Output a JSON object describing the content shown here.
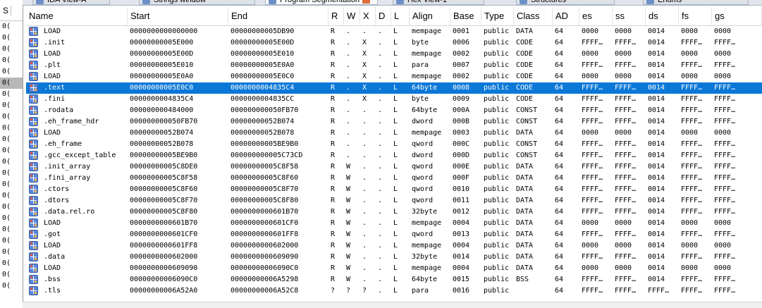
{
  "tabs": [
    {
      "label": "IDA View-A",
      "active": false
    },
    {
      "label": "Strings window",
      "active": false
    },
    {
      "label": "Program Segmentation",
      "active": true
    },
    {
      "label": "Hex View-1",
      "active": false
    },
    {
      "label": "Structures",
      "active": false
    },
    {
      "label": "Enums",
      "active": false
    }
  ],
  "left_panel": {
    "header": "S",
    "row_text": "0("
  },
  "columns": [
    "Name",
    "Start",
    "End",
    "R",
    "W",
    "X",
    "D",
    "L",
    "Align",
    "Base",
    "Type",
    "Class",
    "AD",
    "es",
    "ss",
    "ds",
    "fs",
    "gs"
  ],
  "selected_row": 5,
  "rows": [
    [
      "LOAD",
      "0000000000000000",
      "00000000005DB90",
      "R",
      ".",
      ".",
      ".",
      "L",
      "mempage",
      "0001",
      "public",
      "DATA",
      "64",
      "0000",
      "0000",
      "0014",
      "0000",
      "0000"
    ],
    [
      ".init",
      "00000000005E000",
      "00000000005E00D",
      "R",
      ".",
      "X",
      ".",
      "L",
      "byte",
      "0006",
      "public",
      "CODE",
      "64",
      "FFFF…",
      "FFFF…",
      "0014",
      "FFFF…",
      "FFFF…"
    ],
    [
      "LOAD",
      "00000000005E00D",
      "00000000005E010",
      "R",
      ".",
      "X",
      ".",
      "L",
      "mempage",
      "0002",
      "public",
      "CODE",
      "64",
      "0000",
      "0000",
      "0014",
      "0000",
      "0000"
    ],
    [
      ".plt",
      "00000000005E010",
      "00000000005E0A0",
      "R",
      ".",
      "X",
      ".",
      "L",
      "para",
      "0007",
      "public",
      "CODE",
      "64",
      "FFFF…",
      "FFFF…",
      "0014",
      "FFFF…",
      "FFFF…"
    ],
    [
      "LOAD",
      "00000000005E0A0",
      "00000000005E0C0",
      "R",
      ".",
      "X",
      ".",
      "L",
      "mempage",
      "0002",
      "public",
      "CODE",
      "64",
      "0000",
      "0000",
      "0014",
      "0000",
      "0000"
    ],
    [
      ".text",
      "00000000005E0C0",
      "0000000004835C4",
      "R",
      ".",
      "X",
      ".",
      "L",
      "64byte",
      "0008",
      "public",
      "CODE",
      "64",
      "FFFF…",
      "FFFF…",
      "0014",
      "FFFF…",
      "FFFF…"
    ],
    [
      ".fini",
      "0000000004835C4",
      "0000000004835CC",
      "R",
      ".",
      "X",
      ".",
      "L",
      "byte",
      "0009",
      "public",
      "CODE",
      "64",
      "FFFF…",
      "FFFF…",
      "0014",
      "FFFF…",
      "FFFF…"
    ],
    [
      ".rodata",
      "000000000484000",
      "000000000050FB70",
      "R",
      ".",
      ".",
      ".",
      "L",
      "64byte",
      "000A",
      "public",
      "CONST",
      "64",
      "FFFF…",
      "FFFF…",
      "0014",
      "FFFF…",
      "FFFF…"
    ],
    [
      ".eh_frame_hdr",
      "000000000050FB70",
      "00000000052B074",
      "R",
      ".",
      ".",
      ".",
      "L",
      "dword",
      "000B",
      "public",
      "CONST",
      "64",
      "FFFF…",
      "FFFF…",
      "0014",
      "FFFF…",
      "FFFF…"
    ],
    [
      "LOAD",
      "00000000052B074",
      "00000000052B078",
      "R",
      ".",
      ".",
      ".",
      "L",
      "mempage",
      "0003",
      "public",
      "DATA",
      "64",
      "0000",
      "0000",
      "0014",
      "0000",
      "0000"
    ],
    [
      ".eh_frame",
      "00000000052B078",
      "00000000005BE9B0",
      "R",
      ".",
      ".",
      ".",
      "L",
      "qword",
      "000C",
      "public",
      "CONST",
      "64",
      "FFFF…",
      "FFFF…",
      "0014",
      "FFFF…",
      "FFFF…"
    ],
    [
      ".gcc_except_table",
      "00000000005BE9B0",
      "000000000005C73CD",
      "R",
      ".",
      ".",
      ".",
      "L",
      "dword",
      "000D",
      "public",
      "CONST",
      "64",
      "FFFF…",
      "FFFF…",
      "0014",
      "FFFF…",
      "FFFF…"
    ],
    [
      ".init_array",
      "00000000005C8DE0",
      "00000000005C8F58",
      "R",
      "W",
      ".",
      ".",
      "L",
      "qword",
      "000E",
      "public",
      "DATA",
      "64",
      "FFFF…",
      "FFFF…",
      "0014",
      "FFFF…",
      "FFFF…"
    ],
    [
      ".fini_array",
      "00000000005C8F58",
      "00000000005C8F60",
      "R",
      "W",
      ".",
      ".",
      "L",
      "qword",
      "000F",
      "public",
      "DATA",
      "64",
      "FFFF…",
      "FFFF…",
      "0014",
      "FFFF…",
      "FFFF…"
    ],
    [
      ".ctors",
      "00000000005C8F60",
      "00000000005C8F70",
      "R",
      "W",
      ".",
      ".",
      "L",
      "qword",
      "0010",
      "public",
      "DATA",
      "64",
      "FFFF…",
      "FFFF…",
      "0014",
      "FFFF…",
      "FFFF…"
    ],
    [
      ".dtors",
      "00000000005C8F70",
      "00000000005C8F80",
      "R",
      "W",
      ".",
      ".",
      "L",
      "qword",
      "0011",
      "public",
      "DATA",
      "64",
      "FFFF…",
      "FFFF…",
      "0014",
      "FFFF…",
      "FFFF…"
    ],
    [
      ".data.rel.ro",
      "00000000005C8F80",
      "0000000000601B70",
      "R",
      "W",
      ".",
      ".",
      "L",
      "32byte",
      "0012",
      "public",
      "DATA",
      "64",
      "FFFF…",
      "FFFF…",
      "0014",
      "FFFF…",
      "FFFF…"
    ],
    [
      "LOAD",
      "0000000000601B70",
      "0000000000601CF0",
      "R",
      "W",
      ".",
      ".",
      "L",
      "mempage",
      "0004",
      "public",
      "DATA",
      "64",
      "0000",
      "0000",
      "0014",
      "0000",
      "0000"
    ],
    [
      ".got",
      "0000000000601CF0",
      "0000000000601FF8",
      "R",
      "W",
      ".",
      ".",
      "L",
      "qword",
      "0013",
      "public",
      "DATA",
      "64",
      "FFFF…",
      "FFFF…",
      "0014",
      "FFFF…",
      "FFFF…"
    ],
    [
      "LOAD",
      "0000000000601FF8",
      "0000000000602000",
      "R",
      "W",
      ".",
      ".",
      "L",
      "mempage",
      "0004",
      "public",
      "DATA",
      "64",
      "0000",
      "0000",
      "0014",
      "0000",
      "0000"
    ],
    [
      ".data",
      "0000000000602000",
      "0000000000609090",
      "R",
      "W",
      ".",
      ".",
      "L",
      "32byte",
      "0014",
      "public",
      "DATA",
      "64",
      "FFFF…",
      "FFFF…",
      "0014",
      "FFFF…",
      "FFFF…"
    ],
    [
      "LOAD",
      "0000000000609090",
      "00000000006090C0",
      "R",
      "W",
      ".",
      ".",
      "L",
      "mempage",
      "0004",
      "public",
      "DATA",
      "64",
      "0000",
      "0000",
      "0014",
      "0000",
      "0000"
    ],
    [
      ".bss",
      "00000000006090C0",
      "00000000006A5298",
      "R",
      "W",
      ".",
      ".",
      "L",
      "64byte",
      "0015",
      "public",
      "BSS",
      "64",
      "FFFF…",
      "FFFF…",
      "0014",
      "FFFF…",
      "FFFF…"
    ],
    [
      ".tls",
      "00000000006A52A0",
      "00000000006A52C8",
      "?",
      "?",
      "?",
      ".",
      "L",
      "para",
      "0016",
      "public",
      "",
      "64",
      "FFFF…",
      "FFFF…",
      "FFFF…",
      "FFFF…",
      "FFFF…"
    ]
  ],
  "colors": {
    "selection": "#0b78d8",
    "icon": "#5a86d6"
  }
}
